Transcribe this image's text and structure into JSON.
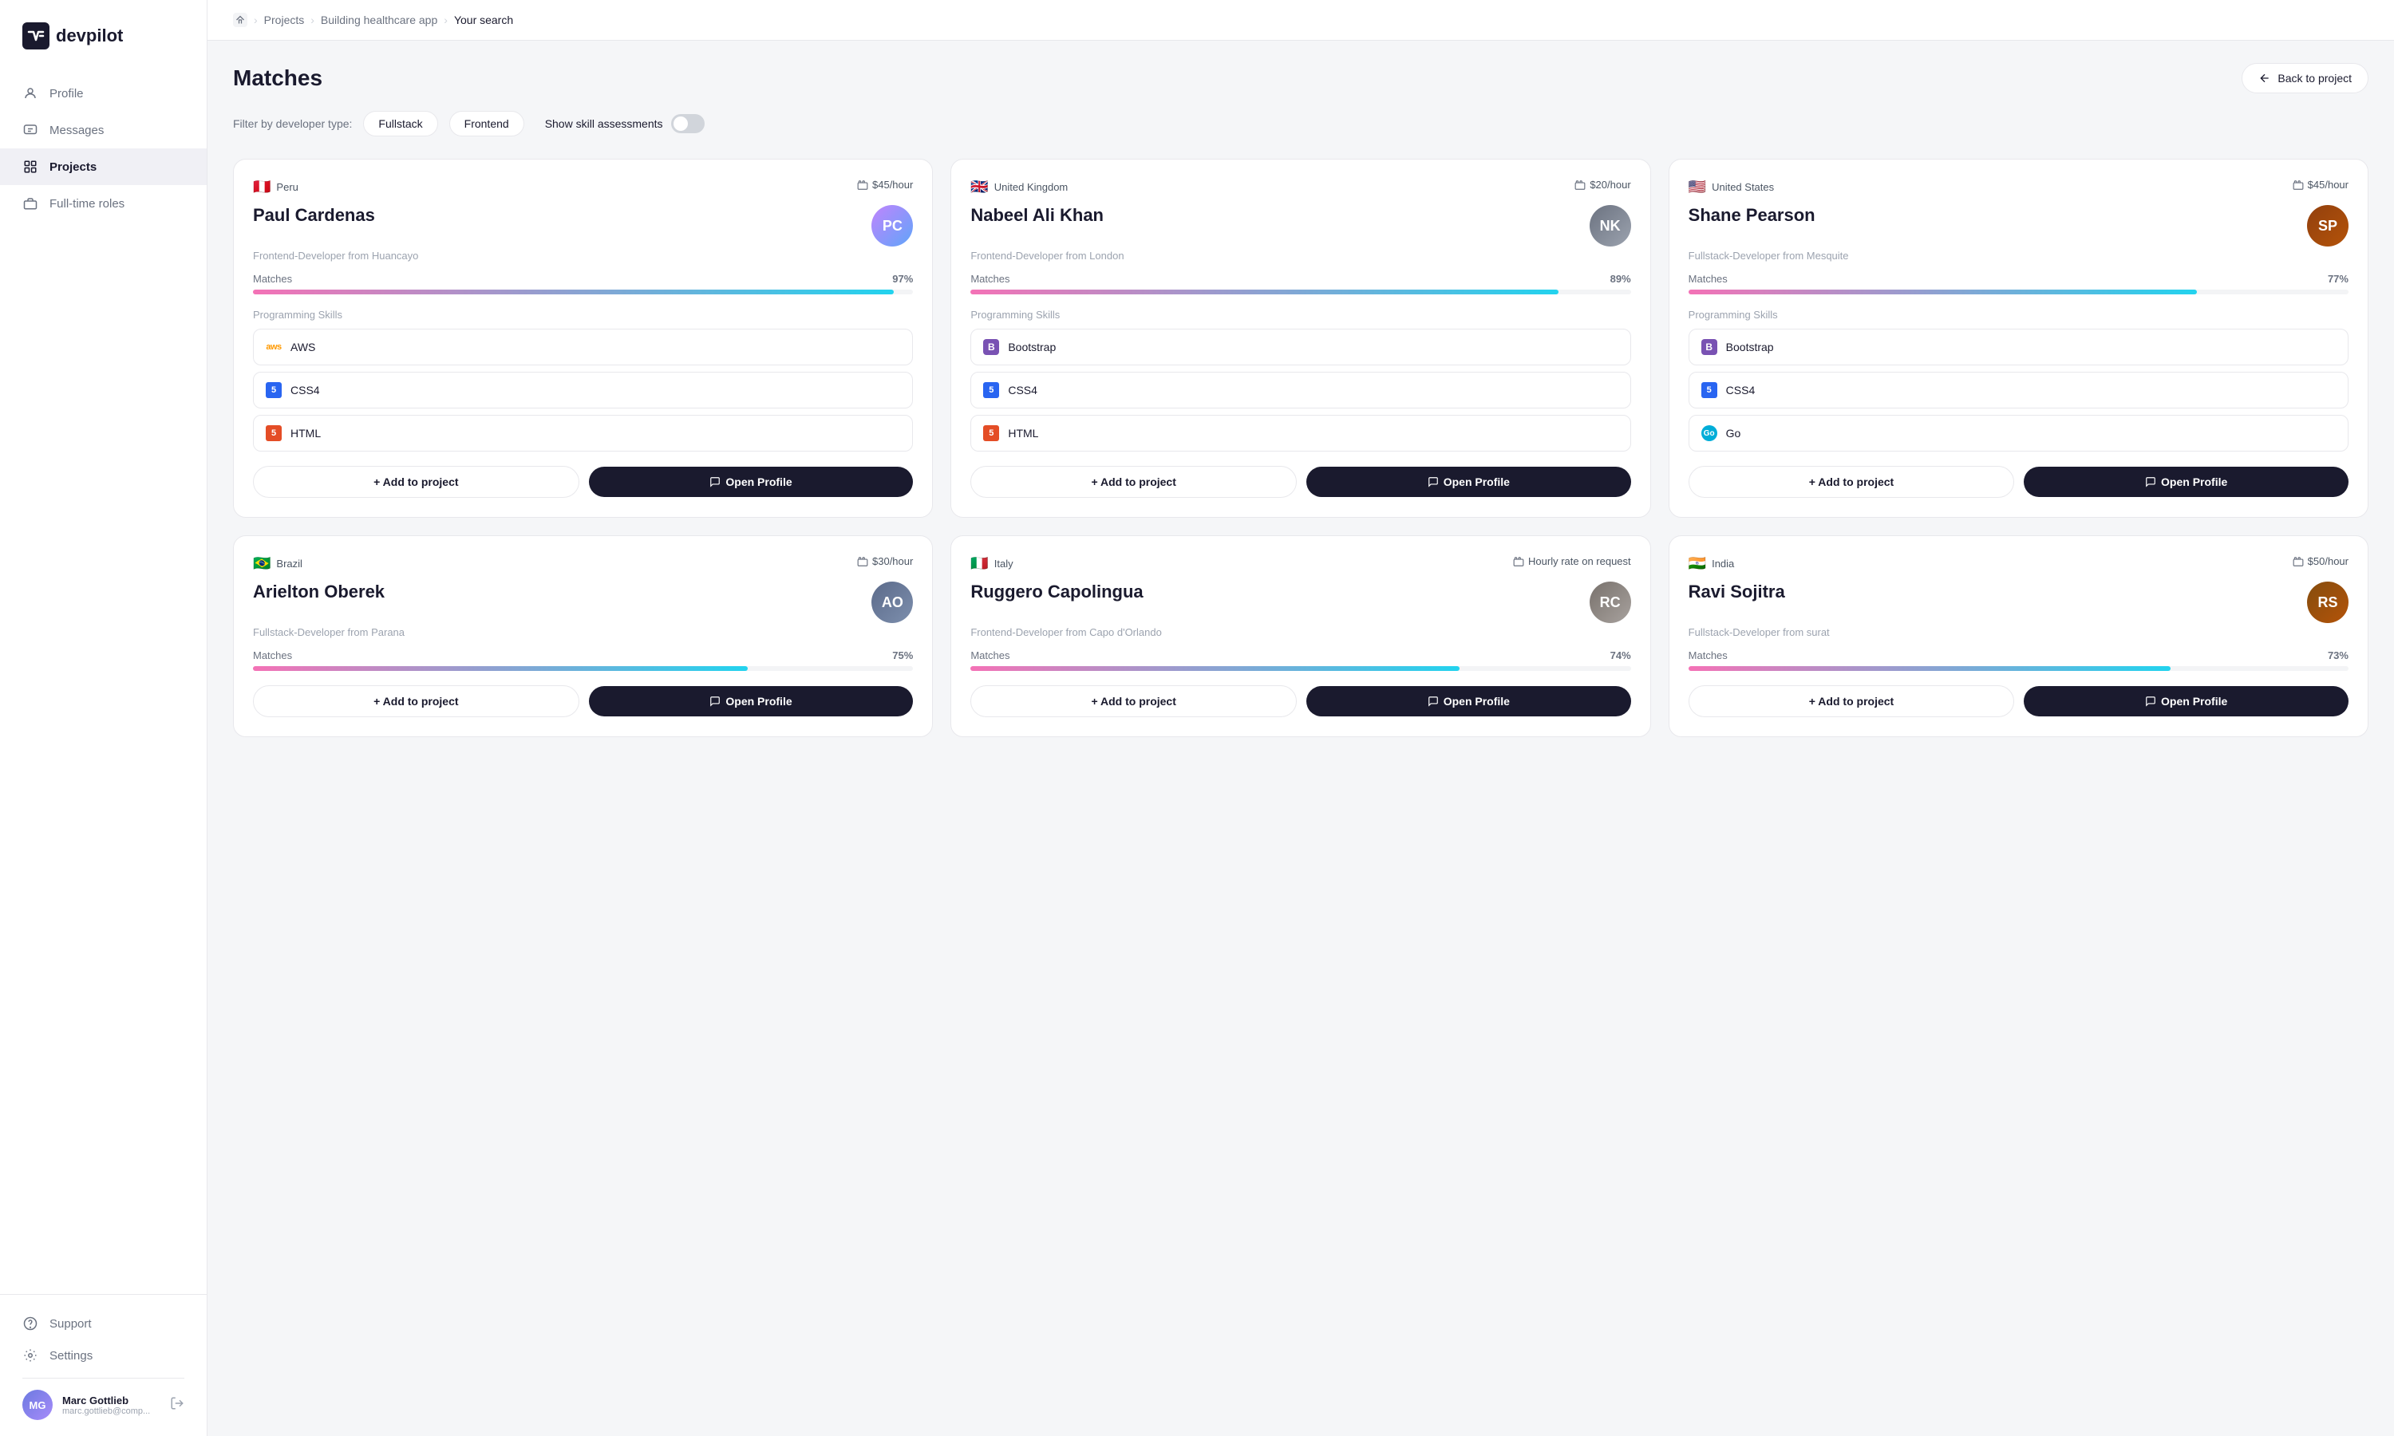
{
  "app": {
    "name": "devpilot"
  },
  "sidebar": {
    "nav_items": [
      {
        "id": "profile",
        "label": "Profile",
        "icon": "person"
      },
      {
        "id": "messages",
        "label": "Messages",
        "icon": "message"
      },
      {
        "id": "projects",
        "label": "Projects",
        "icon": "grid",
        "active": true
      },
      {
        "id": "full-time-roles",
        "label": "Full-time roles",
        "icon": "briefcase"
      }
    ],
    "bottom_items": [
      {
        "id": "support",
        "label": "Support",
        "icon": "help"
      },
      {
        "id": "settings",
        "label": "Settings",
        "icon": "gear"
      }
    ],
    "user": {
      "name": "Marc Gottlieb",
      "email": "marc.gottlieb@comp...",
      "initials": "MG"
    }
  },
  "breadcrumb": {
    "home": "home",
    "projects": "Projects",
    "project": "Building healthcare app",
    "current": "Your search"
  },
  "page": {
    "title": "Matches",
    "back_button": "Back to project"
  },
  "filters": {
    "label": "Filter by developer type:",
    "chips": [
      "Fullstack",
      "Frontend"
    ],
    "toggle_label": "Show skill assessments"
  },
  "developers": [
    {
      "id": 1,
      "country": "Peru",
      "flag": "🇵🇪",
      "rate": "$45/hour",
      "name": "Paul Cardenas",
      "role": "Frontend-Developer from Huancayo",
      "match_pct": 97,
      "skills": [
        {
          "name": "AWS",
          "type": "aws"
        },
        {
          "name": "CSS4",
          "type": "css"
        },
        {
          "name": "HTML",
          "type": "html"
        }
      ],
      "initials": "PC"
    },
    {
      "id": 2,
      "country": "United Kingdom",
      "flag": "🇬🇧",
      "rate": "$20/hour",
      "name": "Nabeel Ali Khan",
      "role": "Frontend-Developer from London",
      "match_pct": 89,
      "skills": [
        {
          "name": "Bootstrap",
          "type": "bootstrap"
        },
        {
          "name": "CSS4",
          "type": "css"
        },
        {
          "name": "HTML",
          "type": "html"
        }
      ],
      "initials": "NK"
    },
    {
      "id": 3,
      "country": "United States",
      "flag": "🇺🇸",
      "rate": "$45/hour",
      "name": "Shane Pearson",
      "role": "Fullstack-Developer from Mesquite",
      "match_pct": 77,
      "skills": [
        {
          "name": "Bootstrap",
          "type": "bootstrap"
        },
        {
          "name": "CSS4",
          "type": "css"
        },
        {
          "name": "Go",
          "type": "go"
        }
      ],
      "initials": "SP"
    },
    {
      "id": 4,
      "country": "Brazil",
      "flag": "🇧🇷",
      "rate": "$30/hour",
      "name": "Arielton Oberek",
      "role": "Fullstack-Developer from Parana",
      "match_pct": 75,
      "skills": [],
      "initials": "AO"
    },
    {
      "id": 5,
      "country": "Italy",
      "flag": "🇮🇹",
      "rate": "Hourly rate on request",
      "name": "Ruggero Capolingua",
      "role": "Frontend-Developer from Capo d'Orlando",
      "match_pct": 74,
      "skills": [],
      "initials": "RC"
    },
    {
      "id": 6,
      "country": "India",
      "flag": "🇮🇳",
      "rate": "$50/hour",
      "name": "Ravi Sojitra",
      "role": "Fullstack-Developer from surat",
      "match_pct": 73,
      "skills": [],
      "initials": "RS"
    }
  ],
  "buttons": {
    "add_to_project": "+ Add to project",
    "open_profile": "Open Profile"
  }
}
